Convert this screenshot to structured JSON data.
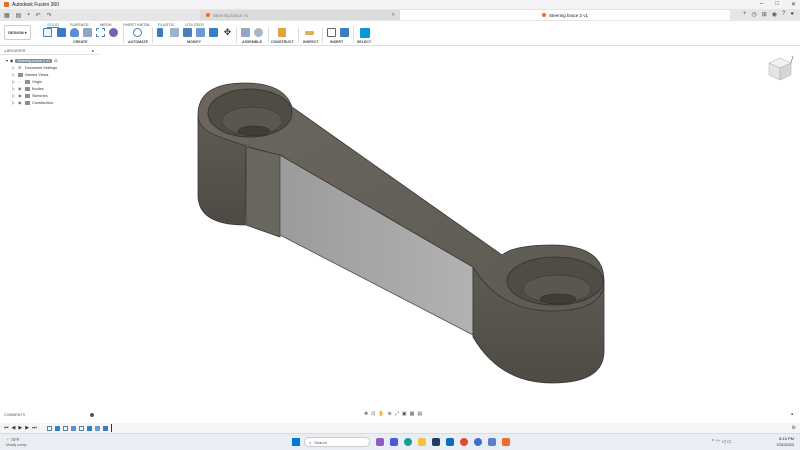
{
  "window": {
    "title": "Autodesk Fusion 360"
  },
  "tabs": [
    {
      "label": "Steering brace v1"
    },
    {
      "label": "Steering brace 2 v1"
    }
  ],
  "toolbar": {
    "workspace": "DESIGN",
    "workspace_tabs": [
      "SOLID",
      "SURFACE",
      "MESH",
      "SHEET METAL",
      "PLASTIC",
      "UTILITIES"
    ],
    "groups": [
      "CREATE",
      "AUTOMATE",
      "MODIFY",
      "ASSEMBLE",
      "CONSTRUCT",
      "INSPECT",
      "INSERT",
      "SELECT"
    ]
  },
  "browser": {
    "title": "BROWSER",
    "root": "Steering brace 2 v1",
    "items": [
      "Document Settings",
      "Named Views",
      "Origin",
      "Bodies",
      "Sketches",
      "Construction"
    ]
  },
  "comments": {
    "label": "COMMENTS"
  },
  "taskbar": {
    "weather_temp": "73°F",
    "weather_desc": "Mostly sunny",
    "search_placeholder": "Search",
    "time": "8:15 PM",
    "date": "7/31/2023"
  },
  "colors": {
    "accent": "#0696d7",
    "fusion_orange": "#f26a21",
    "model_body": "#6e6a61",
    "selected_face": "#a8a8a8"
  }
}
